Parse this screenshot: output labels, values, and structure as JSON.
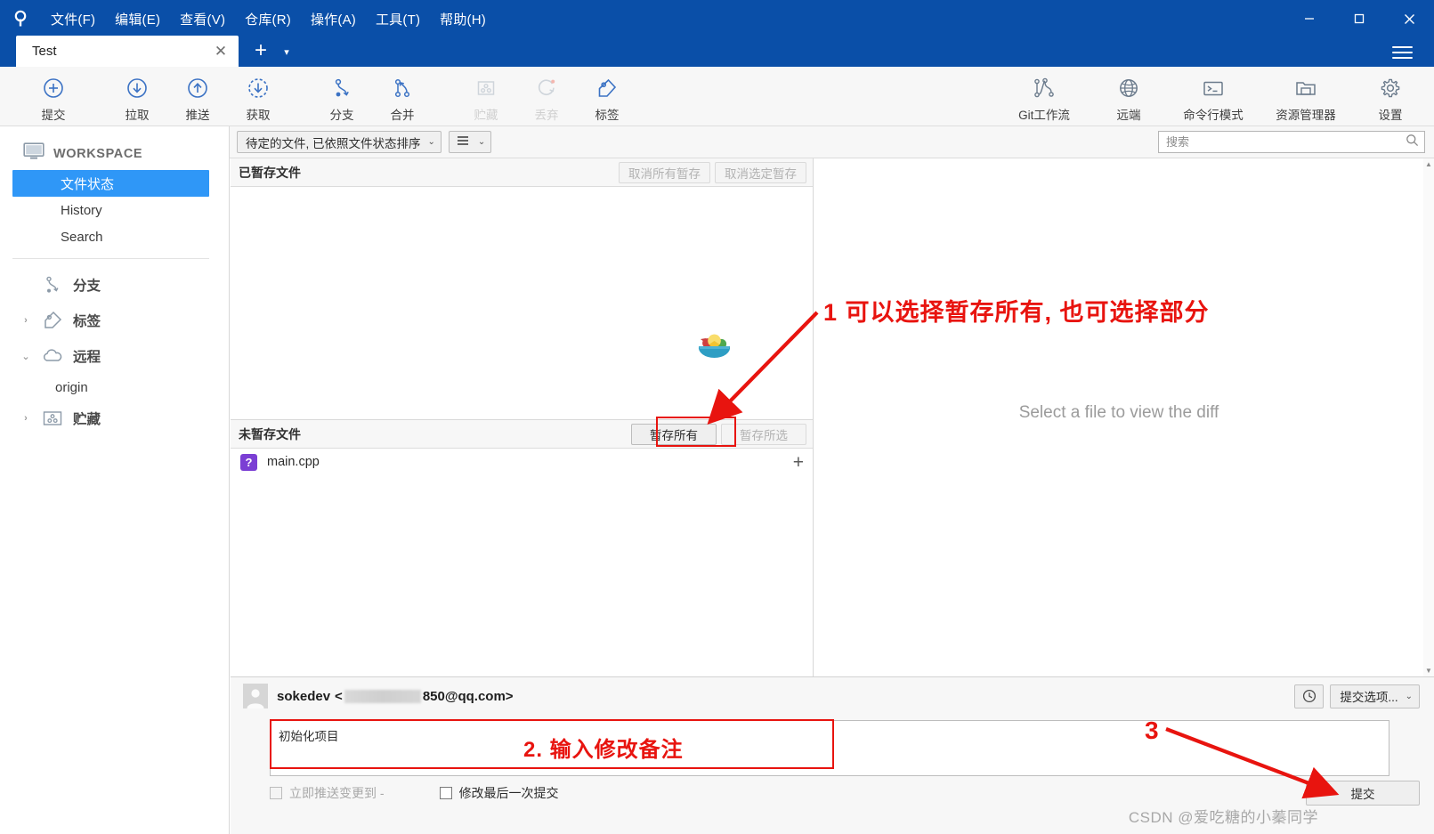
{
  "window": {
    "app_icon": "sourcetree-logo-icon",
    "minimize": "−",
    "maximize": "□",
    "close": "✕",
    "hamburger": "menu-icon"
  },
  "menubar": {
    "items": [
      {
        "label": "文件(F)"
      },
      {
        "label": "编辑(E)"
      },
      {
        "label": "查看(V)"
      },
      {
        "label": "仓库(R)"
      },
      {
        "label": "操作(A)"
      },
      {
        "label": "工具(T)"
      },
      {
        "label": "帮助(H)"
      }
    ]
  },
  "tabs": {
    "active": "Test",
    "close_glyph": "✕",
    "new_glyph": "+",
    "caret_glyph": "▾"
  },
  "toolbar": {
    "left": [
      {
        "label": "提交",
        "icon": "plus-circle-icon",
        "disabled": false
      },
      {
        "label": "拉取",
        "icon": "arrow-down-circle-icon",
        "disabled": false
      },
      {
        "label": "推送",
        "icon": "arrow-up-circle-icon",
        "disabled": false
      },
      {
        "label": "获取",
        "icon": "arrow-down-dashed-circle-icon",
        "disabled": false
      },
      {
        "label": "分支",
        "icon": "branch-icon",
        "disabled": false
      },
      {
        "label": "合并",
        "icon": "merge-icon",
        "disabled": false
      },
      {
        "label": "贮藏",
        "icon": "stash-icon",
        "disabled": true
      },
      {
        "label": "丢弃",
        "icon": "discard-refresh-icon",
        "disabled": true
      },
      {
        "label": "标签",
        "icon": "tag-icon",
        "disabled": false
      }
    ],
    "right": [
      {
        "label": "Git工作流",
        "icon": "gitflow-icon"
      },
      {
        "label": "远端",
        "icon": "globe-icon"
      },
      {
        "label": "命令行模式",
        "icon": "terminal-icon"
      },
      {
        "label": "资源管理器",
        "icon": "folder-explorer-icon"
      },
      {
        "label": "设置",
        "icon": "gear-icon"
      }
    ]
  },
  "sidebar": {
    "workspace_label": "WORKSPACE",
    "workspace_icon": "monitor-icon",
    "items": [
      {
        "label": "文件状态",
        "active": true
      },
      {
        "label": "History",
        "active": false
      },
      {
        "label": "Search",
        "active": false
      }
    ],
    "groups": [
      {
        "label": "分支",
        "icon": "branch-icon",
        "chevron": "",
        "expanded": false
      },
      {
        "label": "标签",
        "icon": "tag-icon",
        "chevron": "›",
        "expanded": false
      },
      {
        "label": "远程",
        "icon": "cloud-icon",
        "chevron": "⌄",
        "expanded": true,
        "children": [
          "origin"
        ]
      },
      {
        "label": "贮藏",
        "icon": "stash-icon",
        "chevron": "›",
        "expanded": false
      }
    ]
  },
  "filterbar": {
    "sort_filter": "待定的文件, 已依照文件状态排序",
    "sort_caret": "⌄",
    "view_mode_icon": "list-view-icon",
    "view_caret": "⌄"
  },
  "search": {
    "placeholder": "搜索",
    "value": "",
    "icon": "search-icon"
  },
  "staged_pane": {
    "title": "已暂存文件",
    "unstage_all_label": "取消所有暂存",
    "unstage_selected_label": "取消选定暂存",
    "unstage_all_disabled": true,
    "unstage_selected_disabled": true,
    "empty_icon": "fruit-bowl-emoji",
    "files": []
  },
  "unstaged_pane": {
    "title": "未暂存文件",
    "stage_all_label": "暂存所有",
    "stage_selected_label": "暂存所选",
    "stage_all_disabled": false,
    "stage_selected_disabled": true,
    "files": [
      {
        "name": "main.cpp",
        "status_badge": "?",
        "badge_color": "#7b3fd4",
        "add_glyph": "+"
      }
    ]
  },
  "diff_pane": {
    "empty_message": "Select a file to view the diff"
  },
  "commit": {
    "author_name": "sokedev",
    "author_email_prefix": "<",
    "author_email_suffix": "850@qq.com>",
    "message_value": "初始化项目",
    "history_icon": "clock-icon",
    "options_label": "提交选项...",
    "options_caret": "⌄",
    "commit_button_label": "提交",
    "checkboxes": [
      {
        "label": "立即推送变更到 -",
        "checked": false,
        "disabled": true
      },
      {
        "label": "修改最后一次提交",
        "checked": false,
        "disabled": false
      }
    ]
  },
  "annotations": {
    "one": "1  可以选择暂存所有, 也可选择部分",
    "two": "2.  输入修改备注",
    "three": "3",
    "color": "#e8140f"
  },
  "watermark": "CSDN @爱吃糖的小蓁同学",
  "colors": {
    "titlebar": "#0a4fa8",
    "accent_selection": "#2f97f7",
    "toolbar_icon": "#3b72c4",
    "annotation_red": "#e8140f",
    "badge_purple": "#7b3fd4"
  }
}
